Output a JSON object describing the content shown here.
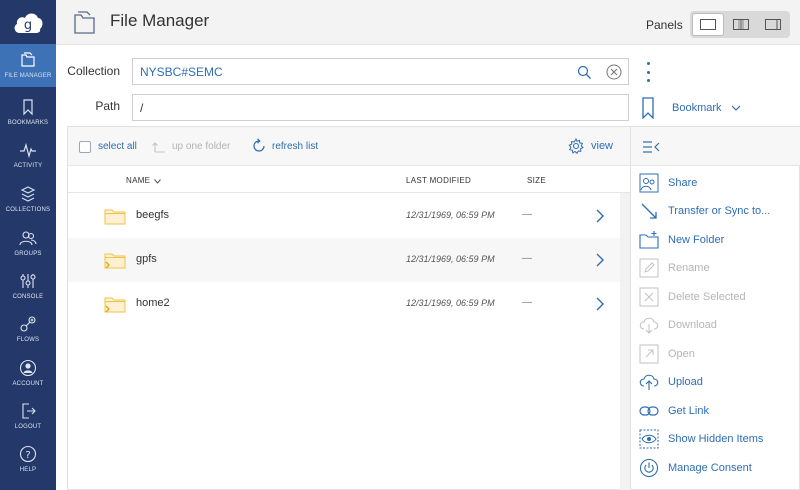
{
  "sidebar": {
    "logo_letter": "g",
    "items": [
      {
        "label": "FILE MANAGER",
        "icon": "file-manager-icon",
        "active": true
      },
      {
        "label": "BOOKMARKS",
        "icon": "bookmark-icon"
      },
      {
        "label": "ACTIVITY",
        "icon": "activity-icon"
      },
      {
        "label": "COLLECTIONS",
        "icon": "collections-icon"
      },
      {
        "label": "GROUPS",
        "icon": "groups-icon"
      },
      {
        "label": "CONSOLE",
        "icon": "console-icon"
      },
      {
        "label": "FLOWS",
        "icon": "flows-icon"
      },
      {
        "label": "ACCOUNT",
        "icon": "account-icon"
      },
      {
        "label": "LOGOUT",
        "icon": "logout-icon"
      },
      {
        "label": "HELP",
        "icon": "help-icon"
      }
    ]
  },
  "header": {
    "title": "File Manager",
    "panels_label": "Panels",
    "panel_options": [
      "single-panel-icon",
      "dual-panel-icon",
      "panel-with-sidebar-icon"
    ],
    "selected_panel": 0
  },
  "collection": {
    "label": "Collection",
    "value": "NYSBC#SEMC"
  },
  "path": {
    "label": "Path",
    "value": "/"
  },
  "bookmark": {
    "label": "Bookmark"
  },
  "toolbar": {
    "select_all": "select all",
    "up_one_folder": "up one folder",
    "refresh_list": "refresh list",
    "view": "view"
  },
  "columns": {
    "name": "NAME",
    "last_modified": "LAST MODIFIED",
    "size": "SIZE"
  },
  "files": [
    {
      "name": "beegfs",
      "modified": "12/31/1969, 06:59 PM",
      "size": "—",
      "icon": "folder-icon"
    },
    {
      "name": "gpfs",
      "modified": "12/31/1969, 06:59 PM",
      "size": "—",
      "icon": "shared-folder-icon"
    },
    {
      "name": "home2",
      "modified": "12/31/1969, 06:59 PM",
      "size": "—",
      "icon": "shared-folder-icon"
    }
  ],
  "actions": [
    {
      "label": "Share",
      "icon": "share-icon",
      "enabled": true
    },
    {
      "label": "Transfer or Sync to...",
      "icon": "transfer-icon",
      "enabled": true
    },
    {
      "label": "New Folder",
      "icon": "new-folder-icon",
      "enabled": true
    },
    {
      "label": "Rename",
      "icon": "rename-icon",
      "enabled": false
    },
    {
      "label": "Delete Selected",
      "icon": "delete-icon",
      "enabled": false
    },
    {
      "label": "Download",
      "icon": "download-icon",
      "enabled": false
    },
    {
      "label": "Open",
      "icon": "open-icon",
      "enabled": false
    },
    {
      "label": "Upload",
      "icon": "upload-icon",
      "enabled": true
    },
    {
      "label": "Get Link",
      "icon": "link-icon",
      "enabled": true
    },
    {
      "label": "Show Hidden Items",
      "icon": "eye-icon",
      "enabled": true
    },
    {
      "label": "Manage Consent",
      "icon": "power-icon",
      "enabled": true
    }
  ],
  "colors": {
    "sidebar_bg": "#24396a",
    "sidebar_active": "#3e72b6",
    "accent_blue": "#2f6db4",
    "folder_yellow": "#f3c24a",
    "disabled_grey": "#b5b5b5"
  }
}
